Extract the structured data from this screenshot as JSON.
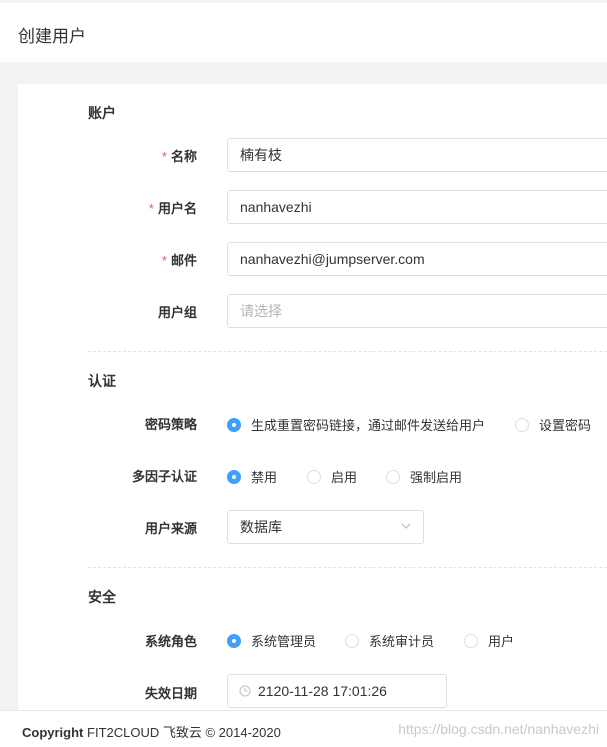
{
  "page": {
    "title": "创建用户"
  },
  "sections": {
    "account": "账户",
    "auth": "认证",
    "security": "安全"
  },
  "fields": {
    "name": {
      "label": "名称",
      "required": "*",
      "value": "楠有枝"
    },
    "username": {
      "label": "用户名",
      "required": "*",
      "value": "nanhavezhi"
    },
    "email": {
      "label": "邮件",
      "required": "*",
      "value": "nanhavezhi@jumpserver.com"
    },
    "groups": {
      "label": "用户组",
      "placeholder": "请选择"
    },
    "password_strategy": {
      "label": "密码策略",
      "options": [
        "生成重置密码链接，通过邮件发送给用户",
        "设置密码"
      ],
      "selected": 0
    },
    "mfa": {
      "label": "多因子认证",
      "options": [
        "禁用",
        "启用",
        "强制启用"
      ],
      "selected": 0
    },
    "source": {
      "label": "用户来源",
      "value": "数据库"
    },
    "role": {
      "label": "系统角色",
      "options": [
        "系统管理员",
        "系统审计员",
        "用户"
      ],
      "selected": 0
    },
    "expire": {
      "label": "失效日期",
      "value": "2120-11-28 17:01:26"
    }
  },
  "footer": {
    "copyright_word": "Copyright",
    "copyright_rest": "FIT2CLOUD 飞致云 © 2014-2020",
    "watermark": "https://blog.csdn.net/nanhavezhi"
  },
  "colors": {
    "accent": "#409eff",
    "required": "#ed5565"
  }
}
